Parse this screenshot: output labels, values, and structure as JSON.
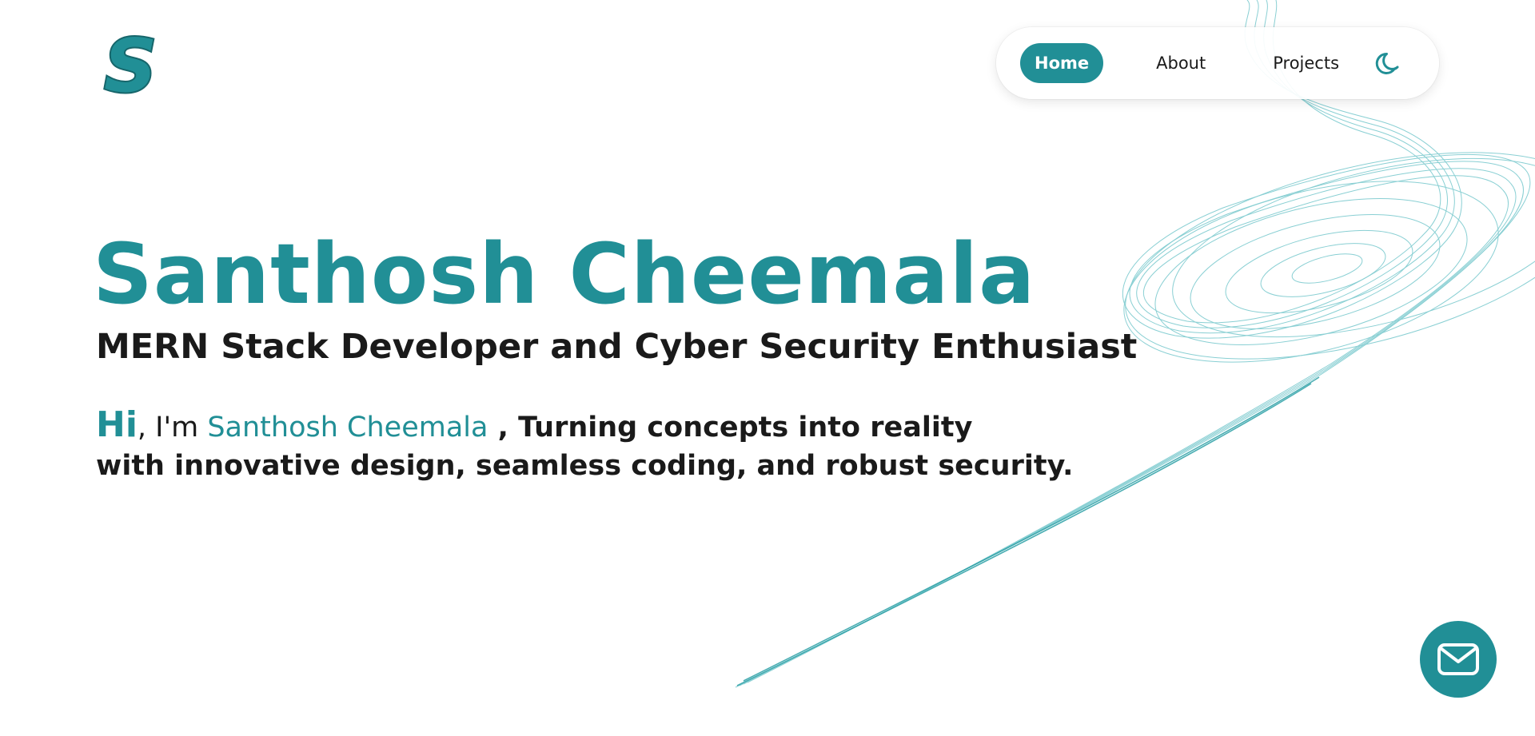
{
  "logo": {
    "letter": "S",
    "icon": "s-logo-icon"
  },
  "nav": {
    "items": [
      {
        "label": "Home",
        "active": true
      },
      {
        "label": "About",
        "active": false
      },
      {
        "label": "Projects",
        "active": false
      }
    ],
    "theme_toggle_icon": "moon-icon"
  },
  "hero": {
    "name": "Santhosh Cheemala",
    "role": "MERN Stack Developer and Cyber Security Enthusiast",
    "intro": {
      "greeting": "Hi",
      "prefix": ", I'm ",
      "name": "Santhosh Cheemala",
      "line1_rest": " , Turning concepts into reality",
      "line2": "with innovative design, seamless coding, and robust security."
    }
  },
  "contact": {
    "icon": "mail-icon"
  },
  "colors": {
    "accent": "#218f96",
    "text": "#1a1a1a",
    "background": "#ffffff"
  }
}
